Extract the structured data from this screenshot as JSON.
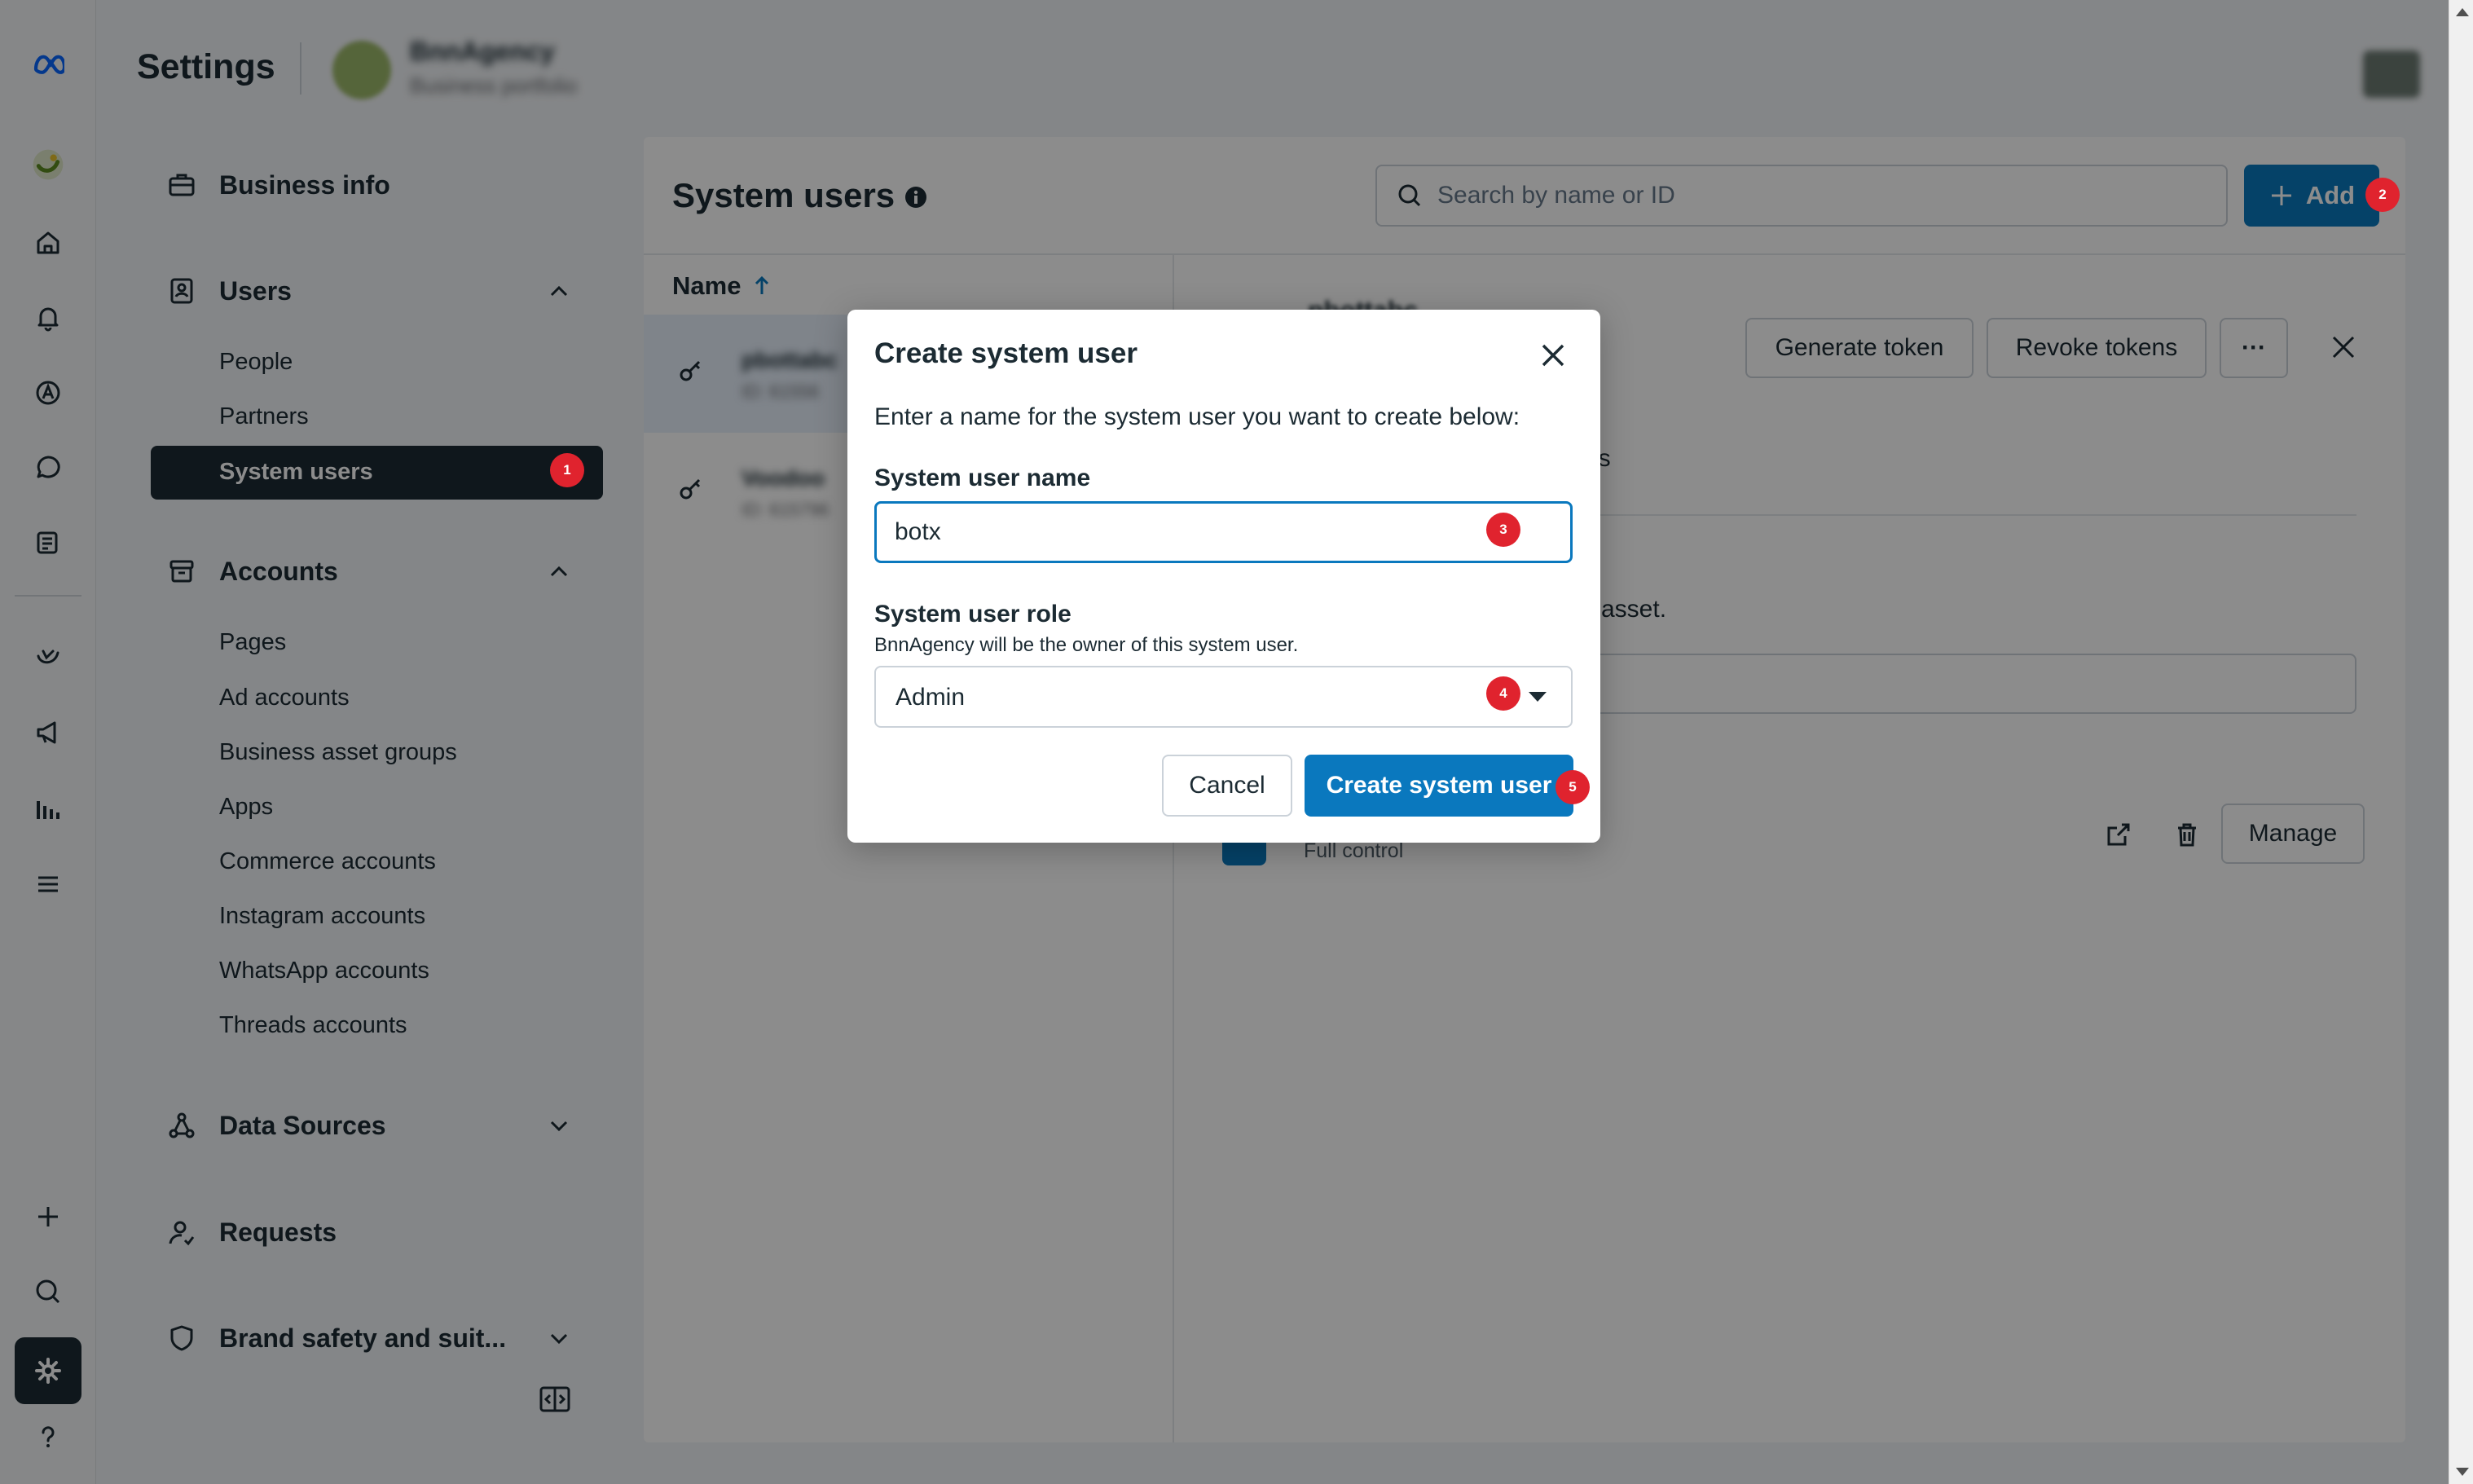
{
  "header": {
    "title": "Settings",
    "business_name": "BnnAgency",
    "business_subtitle": "Business portfolio"
  },
  "nav": {
    "business_info": "Business info",
    "users": {
      "label": "Users",
      "items": [
        "People",
        "Partners",
        "System users"
      ],
      "active": "System users"
    },
    "accounts": {
      "label": "Accounts",
      "items": [
        "Pages",
        "Ad accounts",
        "Business asset groups",
        "Apps",
        "Commerce accounts",
        "Instagram accounts",
        "WhatsApp accounts",
        "Threads accounts"
      ]
    },
    "data_sources": "Data Sources",
    "requests": "Requests",
    "brand_safety": "Brand safety and suit..."
  },
  "badges": [
    "1",
    "2",
    "3",
    "4",
    "5"
  ],
  "main": {
    "title": "System users",
    "search_placeholder": "Search by name or ID",
    "add_label": "Add",
    "column_name": "Name",
    "list": [
      {
        "name": "pbottabc",
        "sub": "ID: 61556"
      },
      {
        "name": "Voodoo",
        "sub": "ID: 615796"
      }
    ],
    "detail": {
      "name": "pbottabc",
      "generate_token": "Generate token",
      "revoke_tokens": "Revoke tokens",
      "more": "···",
      "partial_apps": "ps",
      "partial_asset": "asset.",
      "full_control": "Full control",
      "manage": "Manage"
    }
  },
  "dialog": {
    "title": "Create system user",
    "description": "Enter a name for the system user you want to create below:",
    "name_label": "System user name",
    "name_value": "botx",
    "role_label": "System user role",
    "role_help": "BnnAgency will be the owner of this system user.",
    "role_value": "Admin",
    "cancel": "Cancel",
    "create": "Create system user"
  },
  "colors": {
    "primary": "#0a78be",
    "badge": "#e0232e",
    "dark": "#1c2b33"
  }
}
